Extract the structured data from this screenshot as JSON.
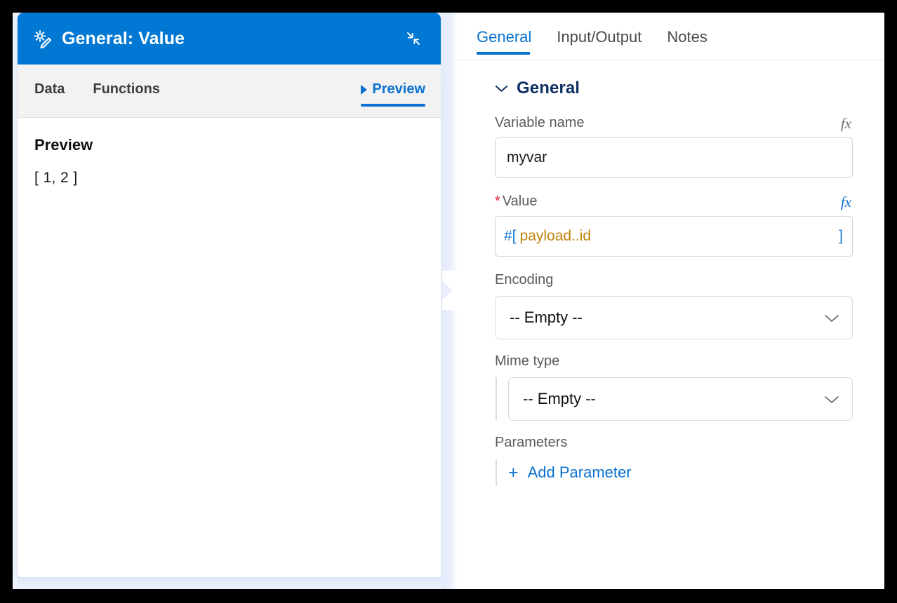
{
  "editor_card": {
    "header": {
      "icon": "gear-pencil-icon",
      "title": "General: Value",
      "collapse_icon": "collapse-arrows-icon"
    },
    "tabs": [
      {
        "label": "Data",
        "active": false
      },
      {
        "label": "Functions",
        "active": false
      },
      {
        "label": "Preview",
        "active": true,
        "icon": "play-triangle-icon"
      }
    ],
    "preview": {
      "heading": "Preview",
      "value": "[ 1, 2 ]"
    }
  },
  "properties_panel": {
    "tabs": [
      {
        "label": "General",
        "active": true
      },
      {
        "label": "Input/Output",
        "active": false
      },
      {
        "label": "Notes",
        "active": false
      }
    ],
    "section": {
      "title": "General",
      "chevron": "chevron-down-icon"
    },
    "fields": {
      "variable_name": {
        "label": "Variable name",
        "value": "myvar",
        "placeholder": "",
        "fx_label": "fx",
        "fx_active": false
      },
      "value": {
        "label": "Value",
        "required_marker": "*",
        "fx_label": "fx",
        "fx_active": true,
        "expression": {
          "open": "#[",
          "body": "payload..id",
          "close": "]"
        }
      },
      "encoding": {
        "label": "Encoding",
        "selected": "-- Empty --",
        "chevron": "chevron-down-icon"
      },
      "mime_type": {
        "label": "Mime type",
        "selected": "-- Empty --",
        "chevron": "chevron-down-icon"
      },
      "parameters": {
        "label": "Parameters",
        "add_label": "Add Parameter",
        "add_icon": "plus-icon"
      }
    }
  },
  "colors": {
    "header_blue": "#0078d4",
    "accent_blue": "#0a71d0",
    "section_navy": "#0e2f62",
    "expr_bracket": "#1878d2",
    "expr_body": "#c1820d",
    "required_red": "#e01b24",
    "gutter": "#e8eefc"
  }
}
